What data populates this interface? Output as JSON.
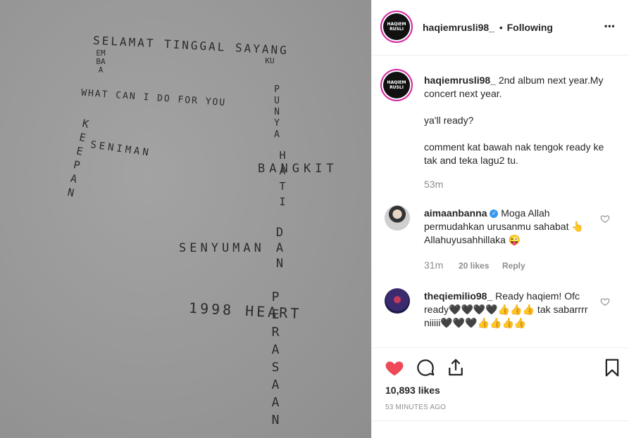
{
  "photo": {
    "line1": "SELAMAT TINGGAL SAYANG",
    "line2": "WHAT CAN I DO FOR YOU",
    "line3": "SENIMAN",
    "line4": "BANGKIT",
    "line5": "SENYUMAN",
    "line6": "1998 HEART",
    "v_kembara": "EMBA A",
    "v_kepian": "KE E P AN",
    "v_ku": "KU",
    "v_punya": "PUNYA",
    "v_hati": "HATI",
    "v_dan": "DAN",
    "v_perasaan": "PERASAAN"
  },
  "header": {
    "username": "haqiemrusli98_",
    "follow_sep": "•",
    "follow_label": "Following",
    "more_icon": "•••",
    "avatar_text1": "HAQIEM",
    "avatar_text2": "RUSLI"
  },
  "caption": {
    "username": "haqiemrusli98_",
    "text1": "2nd album next year.My concert next year.",
    "text2": "ya'll ready?",
    "text3": "comment kat bawah nak tengok ready ke tak and teka lagu2 tu.",
    "time": "53m"
  },
  "comments": [
    {
      "username": "aimaanbanna",
      "verified": true,
      "text": "Moga Allah permudahkan urusanmu sahabat 👆 Allahuyusahhillaka 😜",
      "time": "31m",
      "likes": "20 likes",
      "reply": "Reply"
    },
    {
      "username": "theqiemilio98_",
      "verified": false,
      "text": "Ready haqiem! Ofc ready🖤🖤🖤🖤👍👍👍 tak sabarrrr niiiii🖤🖤🖤👍👍👍👍"
    }
  ],
  "actions": {
    "likes": "10,893 likes",
    "timestamp": "53 MINUTES AGO"
  },
  "colors": {
    "heart": "#ed4956",
    "verified": "#3897f0",
    "ring": "#d6249f"
  }
}
